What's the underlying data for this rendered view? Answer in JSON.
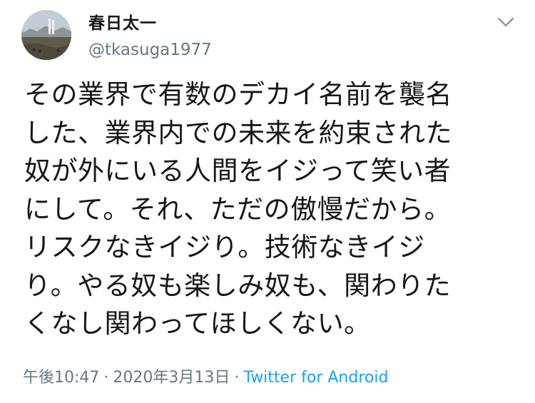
{
  "user": {
    "display_name": "春日太一",
    "handle": "@tkasuga1977",
    "avatar_icon": "profile-photo"
  },
  "menu": {
    "icon": "chevron-down-icon"
  },
  "tweet": {
    "text_lines": [
      "その業界で有数のデカイ名前を襲名",
      "した、業界内での未来を約束された",
      "奴が外にいる人間をイジって笑い者",
      "にして。それ、ただの傲慢だから。",
      "リスクなきイジり。技術なきイジ",
      "り。やる奴も楽しみ奴も、関わりた",
      "くなし関わってほしくない。"
    ]
  },
  "meta": {
    "time": "午後10:47",
    "separator": "·",
    "date": "2020年3月13日",
    "source": "Twitter for Android"
  },
  "colors": {
    "text": "#14171a",
    "secondary": "#657786",
    "link": "#1da1f2"
  }
}
